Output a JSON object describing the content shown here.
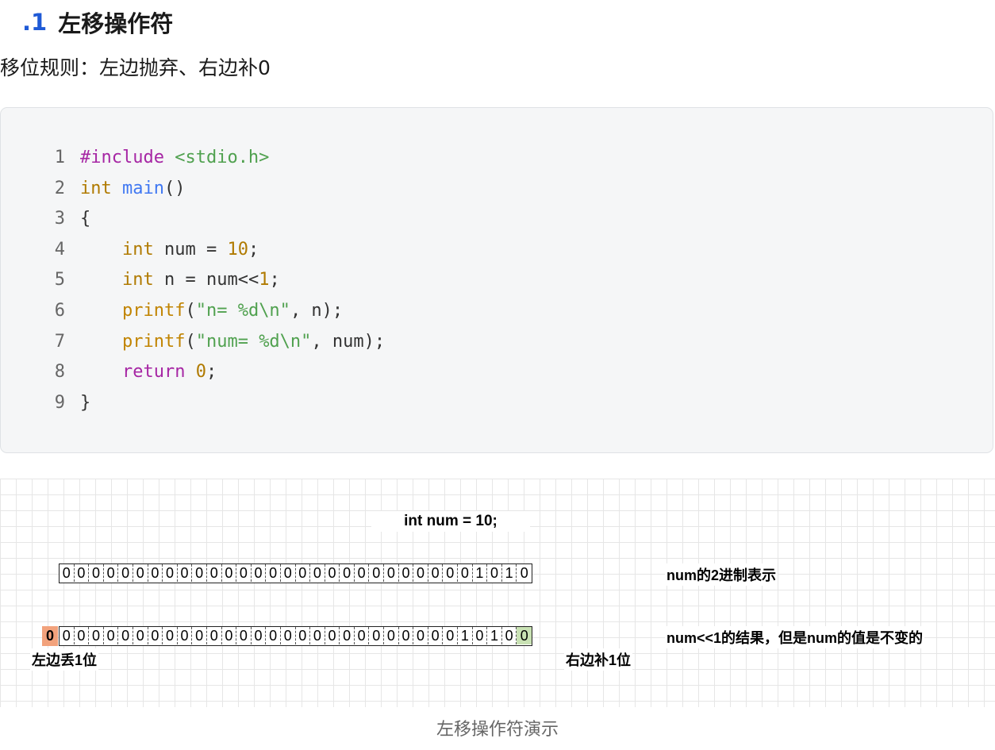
{
  "heading": {
    "number": ".1",
    "title": "左移操作符"
  },
  "rule_text": "移位规则：左边抛弃、右边补0",
  "code": {
    "line_numbers": [
      "1",
      "2",
      "3",
      "4",
      "5",
      "6",
      "7",
      "8",
      "9"
    ],
    "lines": [
      [
        {
          "t": "#include",
          "c": "pp"
        },
        {
          "t": " ",
          "c": "plain"
        },
        {
          "t": "<stdio.h>",
          "c": "str"
        }
      ],
      [
        {
          "t": "int",
          "c": "kw"
        },
        {
          "t": " ",
          "c": "plain"
        },
        {
          "t": "main",
          "c": "fn"
        },
        {
          "t": "()",
          "c": "plain"
        }
      ],
      [
        {
          "t": "{",
          "c": "plain"
        }
      ],
      [
        {
          "t": "    ",
          "c": "plain"
        },
        {
          "t": "int",
          "c": "kw"
        },
        {
          "t": " num = ",
          "c": "plain"
        },
        {
          "t": "10",
          "c": "num"
        },
        {
          "t": ";",
          "c": "plain"
        }
      ],
      [
        {
          "t": "    ",
          "c": "plain"
        },
        {
          "t": "int",
          "c": "kw"
        },
        {
          "t": " n = num<<",
          "c": "plain"
        },
        {
          "t": "1",
          "c": "num"
        },
        {
          "t": ";",
          "c": "plain"
        }
      ],
      [
        {
          "t": "    ",
          "c": "plain"
        },
        {
          "t": "printf",
          "c": "call"
        },
        {
          "t": "(",
          "c": "plain"
        },
        {
          "t": "\"n= %d\\n\"",
          "c": "str"
        },
        {
          "t": ", n);",
          "c": "plain"
        }
      ],
      [
        {
          "t": "    ",
          "c": "plain"
        },
        {
          "t": "printf",
          "c": "call"
        },
        {
          "t": "(",
          "c": "plain"
        },
        {
          "t": "\"num= %d\\n\"",
          "c": "str"
        },
        {
          "t": ", num);",
          "c": "plain"
        }
      ],
      [
        {
          "t": "    ",
          "c": "plain"
        },
        {
          "t": "return",
          "c": "ret"
        },
        {
          "t": " ",
          "c": "plain"
        },
        {
          "t": "0",
          "c": "num"
        },
        {
          "t": ";",
          "c": "plain"
        }
      ],
      [
        {
          "t": "}",
          "c": "plain"
        }
      ]
    ]
  },
  "figure": {
    "title": "int num = 10;",
    "num_bits": [
      "0",
      "0",
      "0",
      "0",
      "0",
      "0",
      "0",
      "0",
      "0",
      "0",
      "0",
      "0",
      "0",
      "0",
      "0",
      "0",
      "0",
      "0",
      "0",
      "0",
      "0",
      "0",
      "0",
      "0",
      "0",
      "0",
      "0",
      "0",
      "1",
      "0",
      "1",
      "0"
    ],
    "shifted_bits": [
      "0",
      "0",
      "0",
      "0",
      "0",
      "0",
      "0",
      "0",
      "0",
      "0",
      "0",
      "0",
      "0",
      "0",
      "0",
      "0",
      "0",
      "0",
      "0",
      "0",
      "0",
      "0",
      "0",
      "0",
      "0",
      "0",
      "0",
      "1",
      "0",
      "1",
      "0",
      "0"
    ],
    "lost_bit": "0",
    "num_label": "num的2进制表示",
    "shifted_label": "num<<1的结果，但是num的值是不变的",
    "left_label": "左边丢1位",
    "right_label": "右边补1位",
    "colors": {
      "lost_bit_fill": "#f2a27c",
      "added_bit_fill": "#c9e2b4"
    }
  },
  "caption": "左移操作符演示"
}
